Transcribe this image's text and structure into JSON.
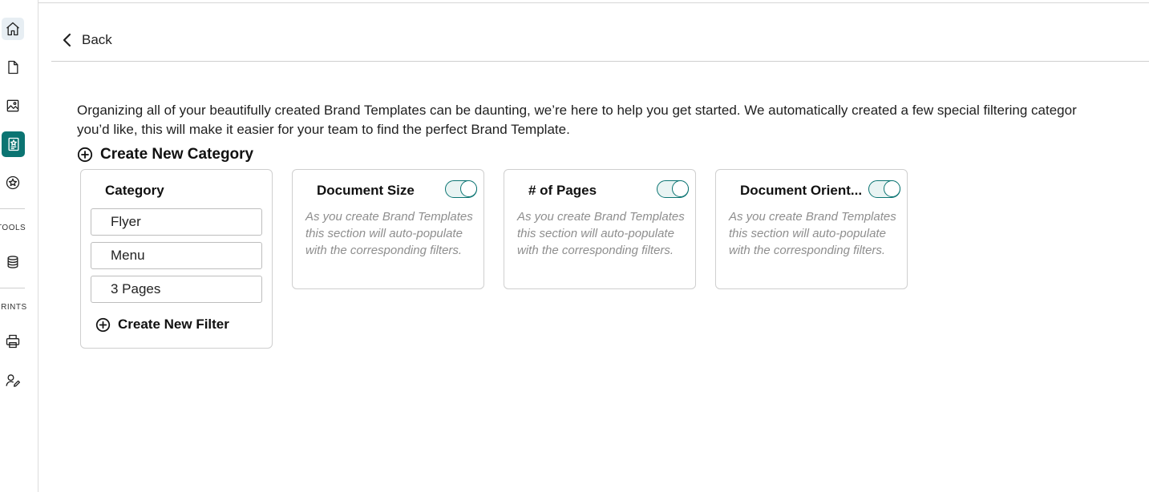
{
  "sidebar": {
    "icons": [
      "home-icon",
      "document-icon",
      "image-icon",
      "brand-template-icon",
      "badge-icon",
      "database-icon",
      "printer-icon",
      "user-edit-icon"
    ],
    "tools_label": "TOOLS",
    "prints_label": "PRINTS",
    "accent_color": "#0b7472"
  },
  "header": {
    "back_label": "Back"
  },
  "intro": {
    "line1": "Organizing all of your beautifully created Brand Templates can be daunting, we’re here to help you get started. We automatically created a few special filtering categor",
    "line2": "you’d like, this will make it easier for your team to find the perfect Brand Template."
  },
  "create_category_label": "Create New Category",
  "category_card": {
    "title": "Category",
    "filters": [
      "Flyer",
      "Menu",
      "3 Pages"
    ],
    "create_filter_label": "Create New Filter"
  },
  "filter_cards": [
    {
      "title": "Document Size",
      "toggle_on": true,
      "description": "As you create Brand Templates this section will auto-populate with the corresponding filters."
    },
    {
      "title": "# of Pages",
      "toggle_on": true,
      "description": "As you create Brand Templates this section will auto-populate with the corresponding filters."
    },
    {
      "title": "Document Orient...",
      "toggle_on": true,
      "description": "As you create Brand Templates this section will auto-populate with the corresponding filters."
    }
  ]
}
